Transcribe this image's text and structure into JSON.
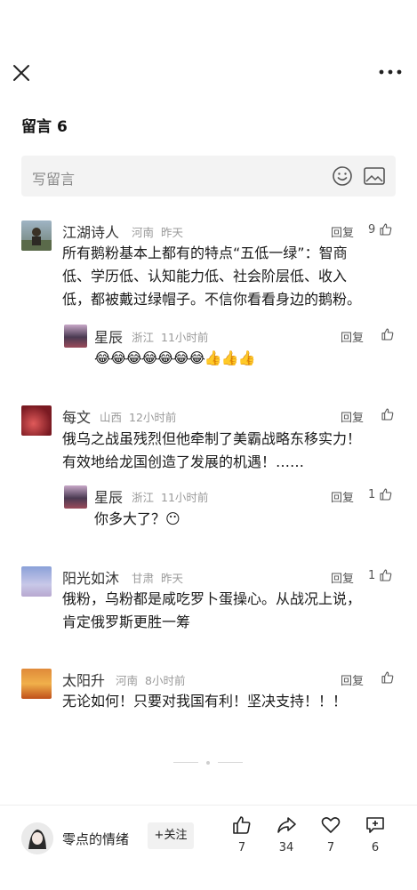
{
  "header": {
    "close_icon": "close-icon",
    "more_icon": "more-icon"
  },
  "comments_section": {
    "title": "留言",
    "count": "6",
    "input_placeholder": "写留言"
  },
  "comments": [
    {
      "name": "江湖诗人",
      "region": "河南",
      "time": "昨天",
      "reply_label": "回复",
      "likes": "9",
      "lines": [
        "所有鹅粉基本上都有的特点“五低一绿”：智商",
        "低、学历低、认知能力低、社会阶层低、收入",
        "低，都被戴过绿帽子。不信你看看身边的鹅粉。"
      ],
      "replies": [
        {
          "name": "星辰",
          "region": "浙江",
          "time": "11小时前",
          "reply_label": "回复",
          "likes": "",
          "emojis": "😂😂😂😂😂😂😂👍👍👍"
        }
      ]
    },
    {
      "name": "每文",
      "region": "山西",
      "time": "12小时前",
      "reply_label": "回复",
      "likes": "",
      "lines": [
        "俄乌之战虽残烈但他牵制了美霸战略东移实力！",
        "有效地给龙国创造了发展的机遇！……"
      ],
      "replies": [
        {
          "name": "星辰",
          "region": "浙江",
          "time": "11小时前",
          "reply_label": "回复",
          "likes": "1",
          "text": "你多大了？😶"
        }
      ]
    },
    {
      "name": "阳光如沐",
      "region": "甘肃",
      "time": "昨天",
      "reply_label": "回复",
      "likes": "1",
      "lines": [
        "俄粉，乌粉都是咸吃罗卜蛋操心。从战况上说，",
        "肯定俄罗斯更胜一筹"
      ]
    },
    {
      "name": "太阳升",
      "region": "河南",
      "time": "8小时前",
      "reply_label": "回复",
      "likes": "",
      "lines": [
        "无论如何！只要对我国有利！坚决支持！！！"
      ]
    }
  ],
  "bottom_bar": {
    "author_name": "零点的情绪",
    "follow_label": "+关注",
    "like_count": "7",
    "share_count": "34",
    "favorite_count": "7",
    "comment_count": "6"
  }
}
